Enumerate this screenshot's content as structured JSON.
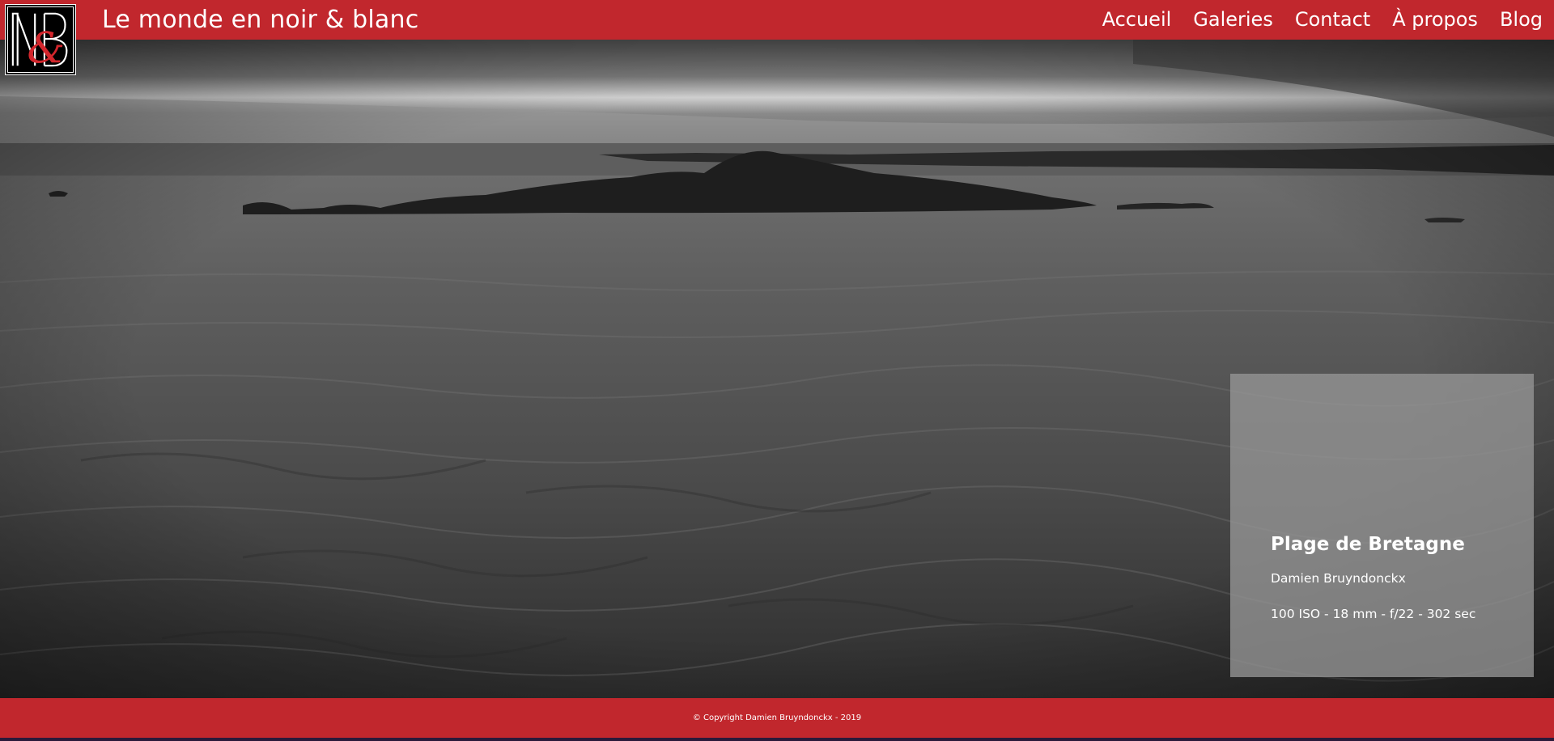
{
  "brand": {
    "logo_letters": "N&B",
    "site_title": "Le monde en noir & blanc"
  },
  "nav": {
    "items": [
      {
        "label": "Accueil"
      },
      {
        "label": "Galeries"
      },
      {
        "label": "Contact"
      },
      {
        "label": "À propos"
      },
      {
        "label": "Blog"
      }
    ]
  },
  "photo": {
    "title": "Plage de Bretagne",
    "author": "Damien Bruyndonckx",
    "exif": "100 ISO - 18 mm - f/22 - 302 sec"
  },
  "footer": {
    "copyright": "© Copyright Damien Bruyndonckx - 2019"
  },
  "colors": {
    "brand_red": "#c1272d",
    "card_overlay": "#969696"
  }
}
